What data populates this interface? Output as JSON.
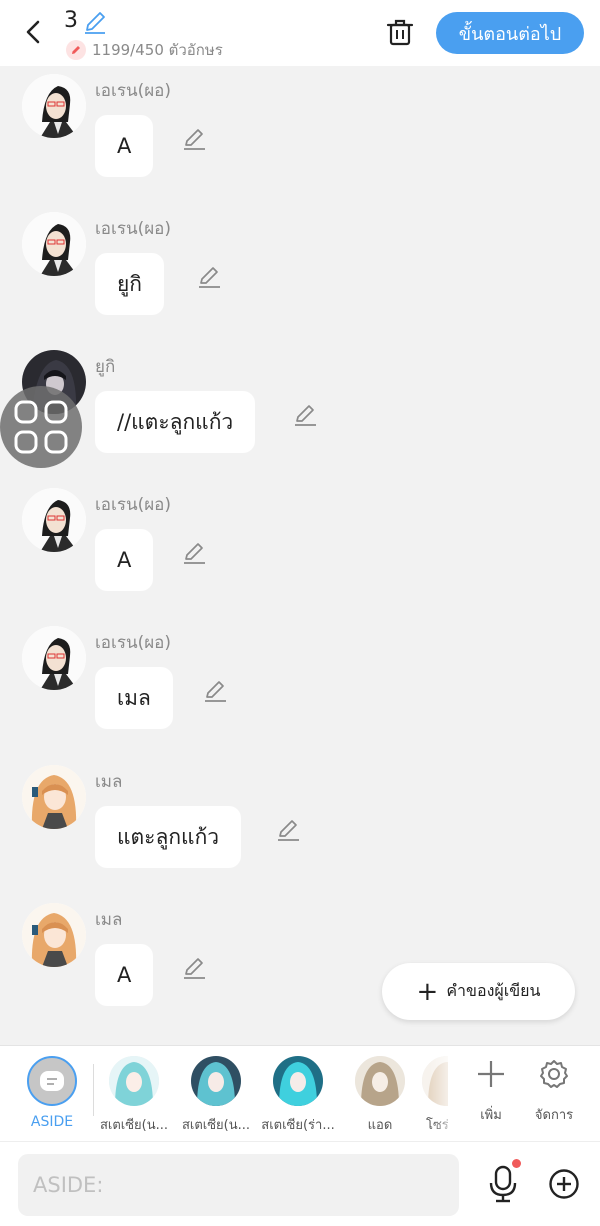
{
  "header": {
    "chapter_number": "3",
    "char_count": "1199/450 ตัวอักษร",
    "next_label": "ขั้นตอนต่อไป"
  },
  "messages": [
    {
      "name": "เอเรน(ผอ)",
      "text": "A",
      "avatar": "glasses-man"
    },
    {
      "name": "เอเรน(ผอ)",
      "text": "ยูกิ",
      "avatar": "glasses-man"
    },
    {
      "name": "ยูกิ",
      "text": "//แตะลูกแก้ว",
      "avatar": "dark-hair"
    },
    {
      "name": "เอเรน(ผอ)",
      "text": "A",
      "avatar": "glasses-man"
    },
    {
      "name": "เอเรน(ผอ)",
      "text": "เมล",
      "avatar": "glasses-man"
    },
    {
      "name": "เมล",
      "text": "แตะลูกแก้ว",
      "avatar": "blonde-girl"
    },
    {
      "name": "เมล",
      "text": "A",
      "avatar": "blonde-girl"
    }
  ],
  "writer_button": {
    "label": "คำของผู้เขียน"
  },
  "characters": [
    {
      "label": "ASIDE"
    },
    {
      "label": "สเตเซีย(น..."
    },
    {
      "label": "สเตเซีย(น..."
    },
    {
      "label": "สเตเซีย(ร่า..."
    },
    {
      "label": "แอด"
    },
    {
      "label": "โซร่"
    }
  ],
  "tools": {
    "add_label": "เพิ่ม",
    "manage_label": "จัดการ"
  },
  "input": {
    "placeholder": "ASIDE:"
  },
  "colors": {
    "accent": "#4a9ff0",
    "background": "#f2f2f2",
    "notification": "#f05a5a"
  }
}
